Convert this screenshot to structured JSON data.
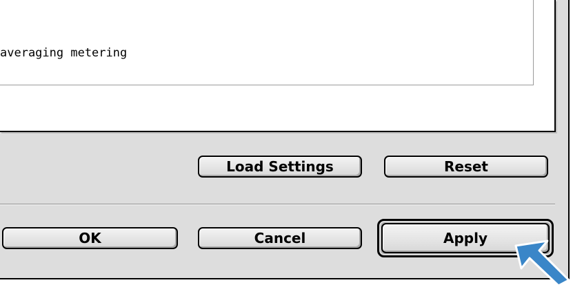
{
  "settings": {
    "metering_text": "averaging metering"
  },
  "actions": {
    "load_settings_label": "Load Settings",
    "reset_label": "Reset"
  },
  "dialog_buttons": {
    "ok_label": "OK",
    "cancel_label": "Cancel",
    "apply_label": "Apply"
  },
  "pointer": {
    "icon": "pointer-arrow-icon",
    "color": "#3a86c8"
  }
}
